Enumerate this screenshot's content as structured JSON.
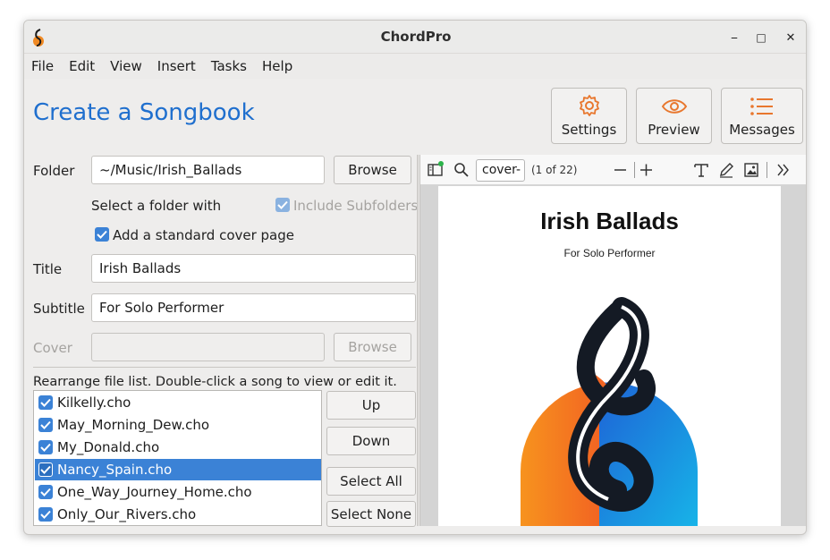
{
  "window": {
    "title": "ChordPro",
    "minimize": "⎯",
    "maximize": "□",
    "close": "✕"
  },
  "menu": [
    "File",
    "Edit",
    "View",
    "Insert",
    "Tasks",
    "Help"
  ],
  "heading": "Create a Songbook",
  "toolbar": {
    "settings": "Settings",
    "preview": "Preview",
    "messages": "Messages"
  },
  "form": {
    "folder_label": "Folder",
    "folder_value": "~/Music/Irish_Ballads",
    "browse": "Browse",
    "select_hint": "Select a folder with",
    "include_subfolders": "Include Subfolders",
    "cover_page": "Add a standard cover page",
    "title_label": "Title",
    "title_value": "Irish Ballads",
    "subtitle_label": "Subtitle",
    "subtitle_value": "For Solo Performer",
    "cover_label": "Cover",
    "cover_value": "",
    "cover_browse": "Browse",
    "rearrange_hint": "Rearrange file list. Double-click a song to view or edit it."
  },
  "files": [
    {
      "name": "Kilkelly.cho",
      "checked": true,
      "selected": false
    },
    {
      "name": "May_Morning_Dew.cho",
      "checked": true,
      "selected": false
    },
    {
      "name": "My_Donald.cho",
      "checked": true,
      "selected": false
    },
    {
      "name": "Nancy_Spain.cho",
      "checked": true,
      "selected": true
    },
    {
      "name": "One_Way_Journey_Home.cho",
      "checked": true,
      "selected": false
    },
    {
      "name": "Only_Our_Rivers.cho",
      "checked": true,
      "selected": false
    }
  ],
  "list_buttons": {
    "up": "Up",
    "down": "Down",
    "select_all": "Select All",
    "select_none": "Select None"
  },
  "viewer": {
    "page_field": "cover-",
    "page_info": "(1 of 22)",
    "page_title": "Irish Ballads",
    "page_subtitle": "For Solo Performer"
  },
  "colors": {
    "accent": "#1f6fce",
    "selection": "#3b82d6",
    "icon_orange": "#e8772e"
  }
}
